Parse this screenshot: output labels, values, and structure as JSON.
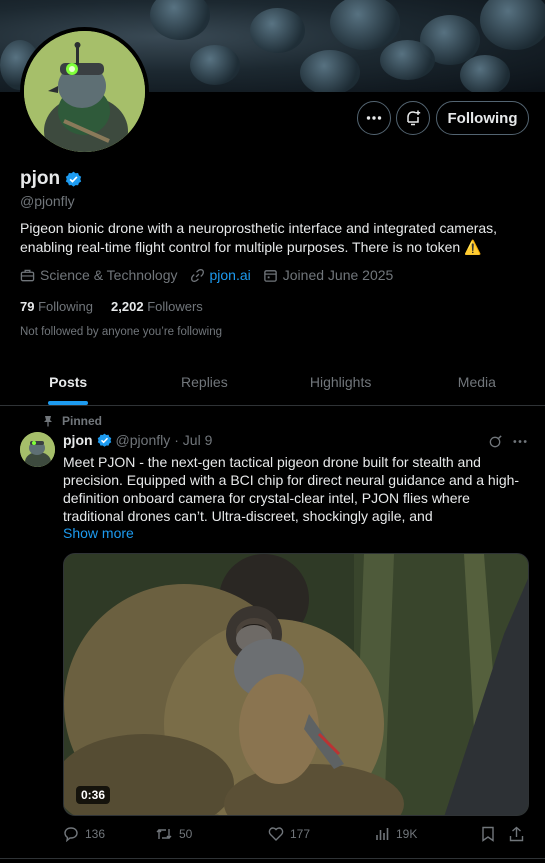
{
  "profile": {
    "name": "pjon",
    "handle": "@pjonfly",
    "bio": "Pigeon bionic drone with a neuroprosthetic interface and integrated cameras, enabling real-time flight control for multiple purposes. There is no token",
    "bio_emoji": "⚠️",
    "category": "Science & Technology",
    "website": "pjon.ai",
    "joined": "Joined June 2025",
    "following_count": "79",
    "following_label": "Following",
    "followers_count": "2,202",
    "followers_label": "Followers",
    "not_followed": "Not followed by anyone you’re following"
  },
  "actions": {
    "following_button": "Following"
  },
  "tabs": [
    {
      "label": "Posts",
      "active": true
    },
    {
      "label": "Replies"
    },
    {
      "label": "Highlights"
    },
    {
      "label": "Media"
    }
  ],
  "post": {
    "pinned_label": "Pinned",
    "author_name": "pjon",
    "author_handle": "@pjonfly",
    "date": "· Jul 9",
    "text": "Meet PJON - the next-gen tactical pigeon drone built for stealth and precision. Equipped with a BCI chip for direct neural guidance and a high-definition onboard camera for crystal-clear intel, PJON flies where traditional drones can’t. Ultra-discreet, shockingly agile, and",
    "show_more": "Show more",
    "video_duration": "0:36",
    "replies": "136",
    "reposts": "50",
    "likes": "177",
    "views": "19K"
  },
  "colors": {
    "accent": "#1d9bf0",
    "muted": "#71767b",
    "text": "#e7e9ea",
    "border": "#2f3336",
    "background": "#000000"
  }
}
